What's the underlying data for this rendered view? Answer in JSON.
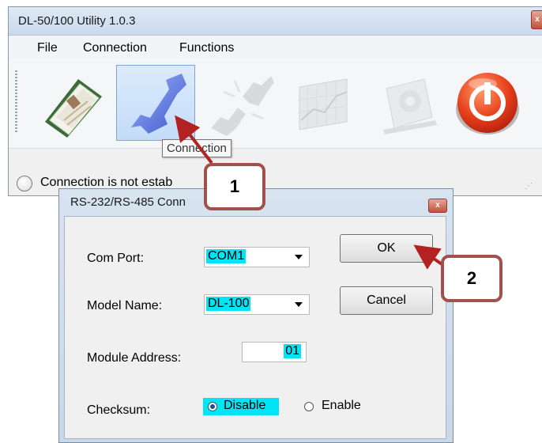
{
  "main_window": {
    "title": "DL-50/100 Utility 1.0.3",
    "close_glyph": "x",
    "menu": [
      "File",
      "Connection",
      "Functions"
    ],
    "toolbar_tools": [
      {
        "icon": "open-file-icon",
        "enabled": true
      },
      {
        "icon": "connect-icon",
        "enabled": true,
        "selected": true
      },
      {
        "icon": "disconnect-icon",
        "enabled": false
      },
      {
        "icon": "chart-icon",
        "enabled": false
      },
      {
        "icon": "settings-icon",
        "enabled": false
      },
      {
        "icon": "power-exit-icon",
        "enabled": true
      }
    ],
    "tooltip": "Connection",
    "status_text": "Connection is not estab"
  },
  "callouts": {
    "step1": "1",
    "step2": "2"
  },
  "dialog": {
    "title": "RS-232/RS-485 Conn",
    "close_glyph": "x",
    "com_port_label": "Com Port:",
    "com_port_value": "COM1",
    "model_name_label": "Model Name:",
    "model_name_value": "DL-100",
    "module_address_label": "Module Address:",
    "module_address_value": "01",
    "checksum_label": "Checksum:",
    "checksum_options": [
      "Disable",
      "Enable"
    ],
    "checksum_selected": "Disable",
    "ok_label": "OK",
    "cancel_label": "Cancel"
  },
  "colors": {
    "highlight": "#00e5f5",
    "callout_border": "#a0514c",
    "arrow": "#b22222"
  }
}
